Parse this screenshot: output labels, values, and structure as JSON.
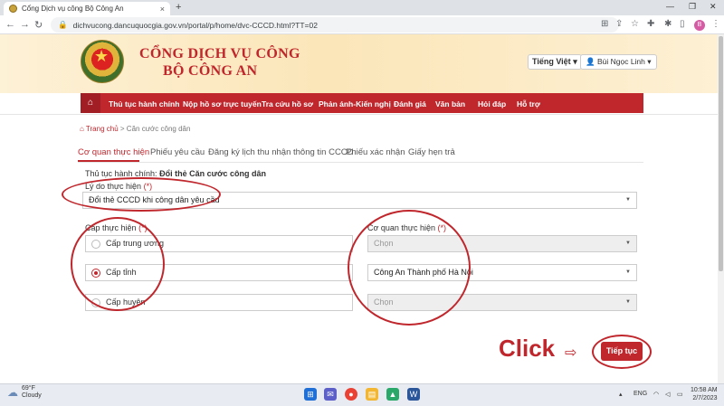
{
  "browser": {
    "tab_title": "Cổng Dịch vụ công Bộ Công An",
    "tab_close": "×",
    "new_tab": "+",
    "url": "dichvucong.dancuquocgia.gov.vn/portal/p/home/dvc-CCCD.html?TT=02",
    "profile_initial": "B"
  },
  "header": {
    "brand_line1": "CỔNG DỊCH VỤ CÔNG",
    "brand_line2": "BỘ CÔNG AN",
    "language": "Tiếng Việt",
    "user_name": "Bùi Ngọc Linh"
  },
  "menu": {
    "items": [
      "Thủ tục hành chính",
      "Nộp hồ sơ trực tuyến",
      "Tra cứu hồ sơ",
      "Phản ánh-Kiến nghị",
      "Đánh giá",
      "Văn bản",
      "Hỏi đáp",
      "Hỗ trợ"
    ]
  },
  "breadcrumb": {
    "home": "Trang chủ",
    "separator": ">",
    "current": "Căn cước công dân"
  },
  "page_tabs": [
    "Cơ quan thực hiện",
    "Phiếu yêu cầu",
    "Đăng ký lịch thu nhận thông tin CCCD",
    "Phiếu xác nhận",
    "Giấy hẹn trả"
  ],
  "form": {
    "procedure_label": "Thủ tục hành chính:",
    "procedure_value": "Đổi thẻ Căn cước công dân",
    "reason_label": "Lý do thực hiện",
    "required_mark": "(*)",
    "reason_value": "Đổi thẻ CCCD khi công dân yêu cầu",
    "level_label": "Cấp thực hiện",
    "levels": [
      "Cấp trung ương",
      "Cấp tỉnh",
      "Cấp huyện"
    ],
    "selected_level": "Cấp tỉnh",
    "agency_label": "Cơ quan thực hiện",
    "agency_selects": [
      "Chọn",
      "Công An Thành phố Hà Nội",
      "Chọn"
    ],
    "next_button": "Tiếp tục"
  },
  "annotation": {
    "click_text": "Click",
    "arrow": "⇨",
    "color": "#c0272d"
  },
  "taskbar": {
    "temperature": "69°F",
    "condition": "Cloudy",
    "language": "ENG",
    "time": "10:58 AM",
    "date": "2/7/2023"
  },
  "colors": {
    "brand_red": "#c0272d",
    "header_gold": "#fbe6b9"
  }
}
